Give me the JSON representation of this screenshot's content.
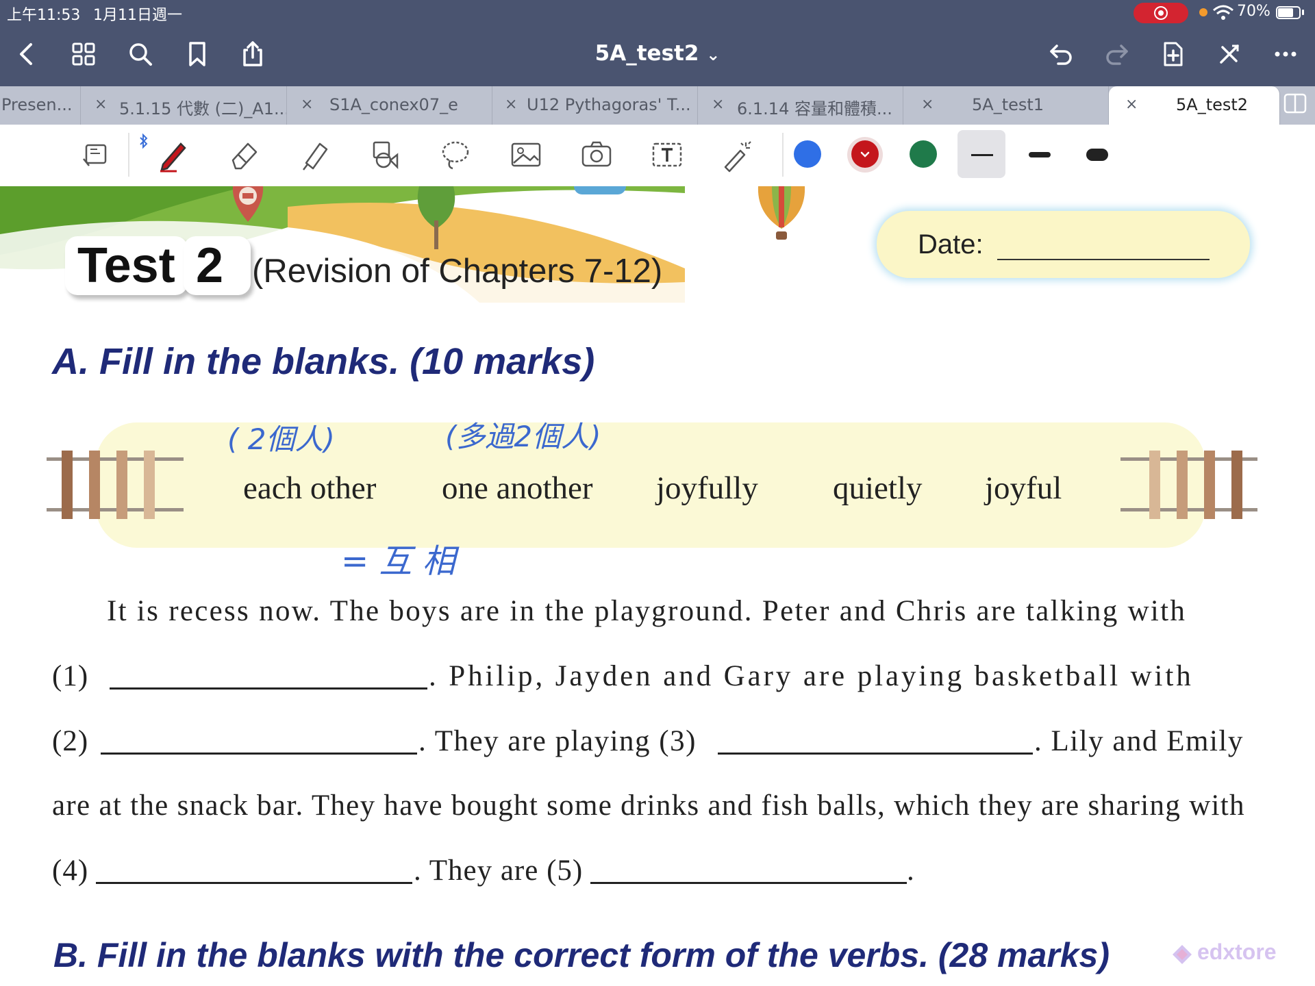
{
  "status_bar": {
    "time": "上午11:53",
    "date": "1月11日週一",
    "battery": "70%"
  },
  "nav": {
    "title": "5A_test2",
    "title_chevron": "⌄"
  },
  "tabs": [
    {
      "label": "Presen..."
    },
    {
      "label": "5.1.15 代數 (二)_A1..."
    },
    {
      "label": "S1A_conex07_e"
    },
    {
      "label": "U12 Pythagoras' T..."
    },
    {
      "label": "6.1.14 容量和體積..."
    },
    {
      "label": "5A_test1"
    },
    {
      "label": "5A_test2",
      "active": true
    }
  ],
  "tab_close": "×",
  "toolbar": {
    "colors": [
      "#2f6fe6",
      "#c4161c",
      "#1f7a4a"
    ],
    "selected_color": "#c4161c"
  },
  "worksheet": {
    "test_word": "Test",
    "test_number": "2",
    "subtitle": "(Revision of Chapters 7-12)",
    "date_label": "Date:",
    "section_a": "A. Fill in the blanks. (10 marks)",
    "word_bank": [
      "each other",
      "one another",
      "joyfully",
      "quietly",
      "joyful"
    ],
    "handwriting": {
      "note_1": "( 2個人)",
      "note_2": "(多過2個人)",
      "note_3": "= 互 相"
    },
    "passage": {
      "line1": "It is recess now. The boys are in the playground. Peter and Chris are talking with",
      "line2_num": "(1)",
      "line2_rest": ". Philip, Jayden and Gary are playing basketball with",
      "line3_num": "(2)",
      "line3_mid": ". They are playing (3)",
      "line3_rest": ". Lily and Emily",
      "line4": "are at the snack bar. They have bought some drinks and fish balls, which they are sharing with",
      "line5_num": "(4)",
      "line5_mid": ". They are  (5)",
      "line5_end": "."
    },
    "section_b": "B.  Fill in the blanks with the correct form of the verbs. (28 marks)",
    "watermark": "edxtore"
  }
}
